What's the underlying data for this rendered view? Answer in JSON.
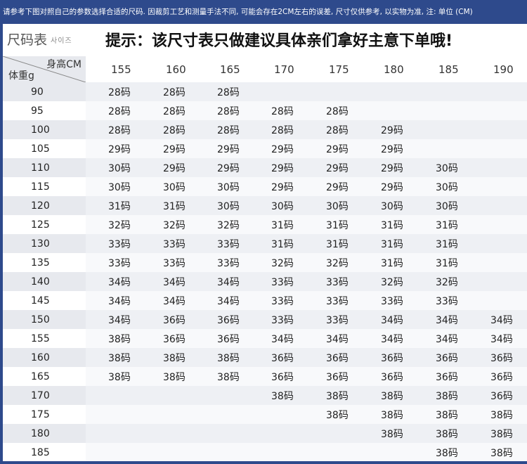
{
  "notice": "请参考下图对照自己的参数选择合适的尺码. 因裁剪工艺和测量手法不同, 可能会存在2CM左右的误差, 尺寸仅供参考, 以实物为准, 注: 单位 (CM)",
  "title": {
    "main": "尺码表",
    "sub": "사이즈",
    "tip": "提示：该尺寸表只做建议具体亲们拿好主意下单哦!"
  },
  "corner": {
    "height_label": "身高CM",
    "weight_label": "体重g"
  },
  "heights": [
    "155",
    "160",
    "165",
    "170",
    "175",
    "180",
    "185",
    "190"
  ],
  "rows": [
    {
      "weight": "90",
      "sizes": [
        "28码",
        "28码",
        "28码",
        "",
        "",
        "",
        "",
        ""
      ]
    },
    {
      "weight": "95",
      "sizes": [
        "28码",
        "28码",
        "28码",
        "28码",
        "28码",
        "",
        "",
        ""
      ]
    },
    {
      "weight": "100",
      "sizes": [
        "28码",
        "28码",
        "28码",
        "28码",
        "28码",
        "29码",
        "",
        ""
      ]
    },
    {
      "weight": "105",
      "sizes": [
        "29码",
        "29码",
        "29码",
        "29码",
        "29码",
        "29码",
        "",
        ""
      ]
    },
    {
      "weight": "110",
      "sizes": [
        "30码",
        "29码",
        "29码",
        "29码",
        "29码",
        "29码",
        "30码",
        ""
      ]
    },
    {
      "weight": "115",
      "sizes": [
        "30码",
        "30码",
        "30码",
        "29码",
        "29码",
        "29码",
        "30码",
        ""
      ]
    },
    {
      "weight": "120",
      "sizes": [
        "31码",
        "31码",
        "30码",
        "30码",
        "30码",
        "30码",
        "30码",
        ""
      ]
    },
    {
      "weight": "125",
      "sizes": [
        "32码",
        "32码",
        "32码",
        "31码",
        "31码",
        "31码",
        "31码",
        ""
      ]
    },
    {
      "weight": "130",
      "sizes": [
        "33码",
        "33码",
        "33码",
        "31码",
        "31码",
        "31码",
        "31码",
        ""
      ]
    },
    {
      "weight": "135",
      "sizes": [
        "33码",
        "33码",
        "33码",
        "32码",
        "32码",
        "31码",
        "31码",
        ""
      ]
    },
    {
      "weight": "140",
      "sizes": [
        "34码",
        "34码",
        "34码",
        "33码",
        "33码",
        "32码",
        "32码",
        ""
      ]
    },
    {
      "weight": "145",
      "sizes": [
        "34码",
        "34码",
        "34码",
        "33码",
        "33码",
        "33码",
        "33码",
        ""
      ]
    },
    {
      "weight": "150",
      "sizes": [
        "34码",
        "36码",
        "36码",
        "33码",
        "33码",
        "34码",
        "34码",
        "34码"
      ]
    },
    {
      "weight": "155",
      "sizes": [
        "38码",
        "36码",
        "36码",
        "34码",
        "34码",
        "34码",
        "34码",
        "34码"
      ]
    },
    {
      "weight": "160",
      "sizes": [
        "38码",
        "38码",
        "38码",
        "36码",
        "36码",
        "36码",
        "36码",
        "36码"
      ]
    },
    {
      "weight": "165",
      "sizes": [
        "38码",
        "38码",
        "38码",
        "36码",
        "36码",
        "36码",
        "36码",
        "36码"
      ]
    },
    {
      "weight": "170",
      "sizes": [
        "",
        "",
        "",
        "38码",
        "38码",
        "38码",
        "38码",
        "36码"
      ]
    },
    {
      "weight": "175",
      "sizes": [
        "",
        "",
        "",
        "",
        "38码",
        "38码",
        "38码",
        "38码"
      ]
    },
    {
      "weight": "180",
      "sizes": [
        "",
        "",
        "",
        "",
        "",
        "38码",
        "38码",
        "38码"
      ]
    },
    {
      "weight": "185",
      "sizes": [
        "",
        "",
        "",
        "",
        "",
        "",
        "38码",
        "38码"
      ]
    }
  ],
  "colors": {
    "frame": "#2e4a8c",
    "stripe": "#eef0f4"
  }
}
